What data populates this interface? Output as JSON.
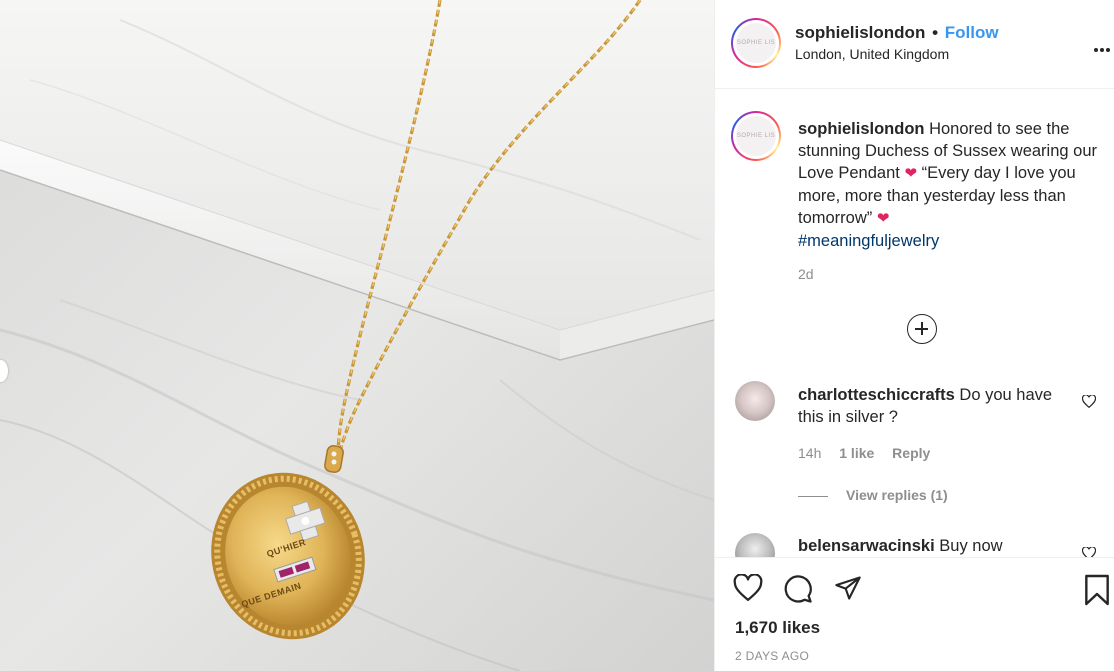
{
  "post": {
    "username": "sophielislondon",
    "follow_label": "Follow",
    "separator": "•",
    "location": "London, United Kingdom",
    "more_label": "•••",
    "avatar_text": "SOPHIE LIS"
  },
  "caption": {
    "username": "sophielislondon",
    "text_part1": "Honored to see the stunning Duchess of Sussex wearing our Love Pendant",
    "text_part2": "“Every day I love you more, more than yesterday less than tomorrow”",
    "hashtag": "#meaningfuljewelry",
    "time": "2d"
  },
  "comments": [
    {
      "username": "charlotteschiccrafts",
      "text": "Do you have this in silver ?",
      "time": "14h",
      "likes": "1 like",
      "reply_label": "Reply",
      "view_replies": "View replies (1)"
    },
    {
      "username": "belensarwacinski",
      "text": "Buy now"
    }
  ],
  "footer": {
    "likes": "1,670 likes",
    "posted": "2 DAYS AGO"
  },
  "pendant": {
    "line1": "QU'HIER",
    "line2": "QUE DEMAIN"
  },
  "icons": {
    "like": "heart-outline-icon",
    "comment": "comment-bubble-icon",
    "share": "paper-plane-icon",
    "save": "bookmark-icon",
    "add_comment": "plus-circle-icon",
    "more": "more-dots-icon"
  },
  "colors": {
    "link_blue": "#3897f0",
    "hashtag": "#00376b",
    "muted": "#8e8e8e",
    "heart_red": "#e0245e"
  }
}
